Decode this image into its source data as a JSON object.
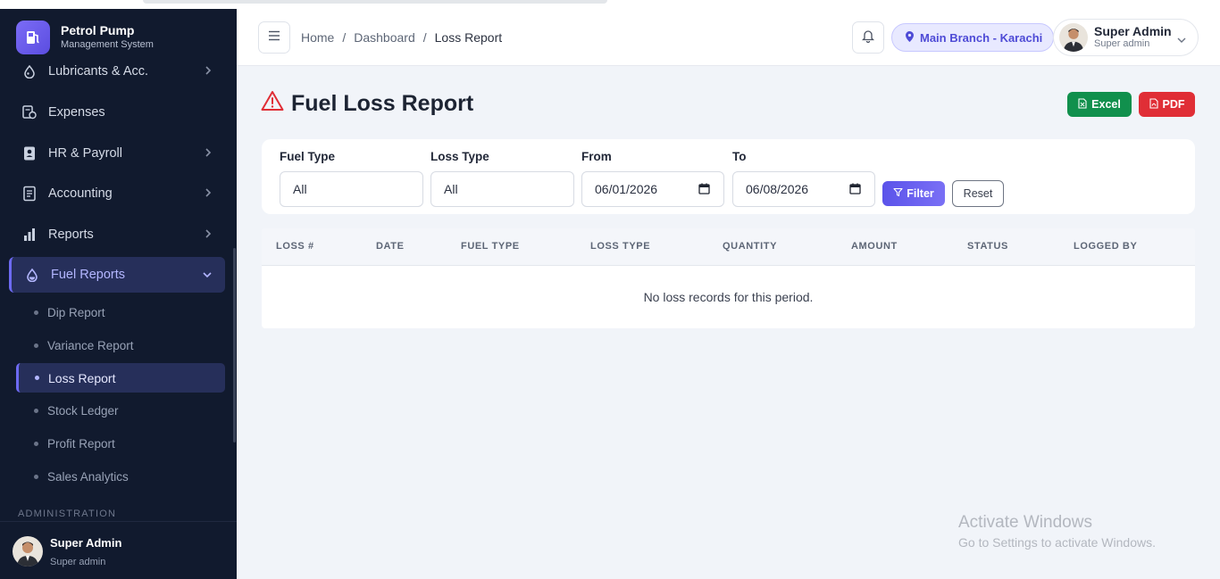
{
  "brand": {
    "title": "Petrol Pump",
    "subtitle": "Management System"
  },
  "sidebar": {
    "items": [
      {
        "label": "Lubricants & Acc.",
        "icon": "droplet-icon"
      },
      {
        "label": "Expenses",
        "icon": "receipt-icon"
      },
      {
        "label": "HR & Payroll",
        "icon": "id-badge-icon"
      },
      {
        "label": "Accounting",
        "icon": "ledger-icon"
      },
      {
        "label": "Reports",
        "icon": "bar-chart-icon"
      },
      {
        "label": "Fuel Reports",
        "icon": "fuel-drop-icon"
      }
    ],
    "sub_items": [
      "Dip Report",
      "Variance Report",
      "Loss Report",
      "Stock Ledger",
      "Profit Report",
      "Sales Analytics"
    ],
    "section_label": "ADMINISTRATION",
    "footer": {
      "name": "Super Admin",
      "role": "Super admin"
    }
  },
  "header": {
    "breadcrumb": [
      "Home",
      "Dashboard",
      "Loss Report"
    ],
    "separator": "/",
    "branch": "Main Branch - Karachi",
    "user": {
      "name": "Super Admin",
      "role": "Super admin"
    }
  },
  "page": {
    "title": "Fuel Loss Report",
    "excel_label": "Excel",
    "pdf_label": "PDF"
  },
  "filters": {
    "fuel_type": {
      "label": "Fuel Type",
      "value": "All"
    },
    "loss_type": {
      "label": "Loss Type",
      "value": "All"
    },
    "from": {
      "label": "From",
      "value": "06/01/2026"
    },
    "to": {
      "label": "To",
      "value": "06/08/2026"
    },
    "filter_label": "Filter",
    "reset_label": "Reset"
  },
  "table": {
    "columns": [
      "LOSS #",
      "DATE",
      "FUEL TYPE",
      "LOSS TYPE",
      "QUANTITY",
      "AMOUNT",
      "STATUS",
      "LOGGED BY"
    ],
    "empty_message": "No loss records for this period."
  },
  "watermark": {
    "line1": "Activate Windows",
    "line2": "Go to Settings to activate Windows."
  },
  "colors": {
    "accent": "#5b53ea",
    "excel": "#11904d",
    "pdf": "#e02e36",
    "sidebar": "#111a2e"
  }
}
